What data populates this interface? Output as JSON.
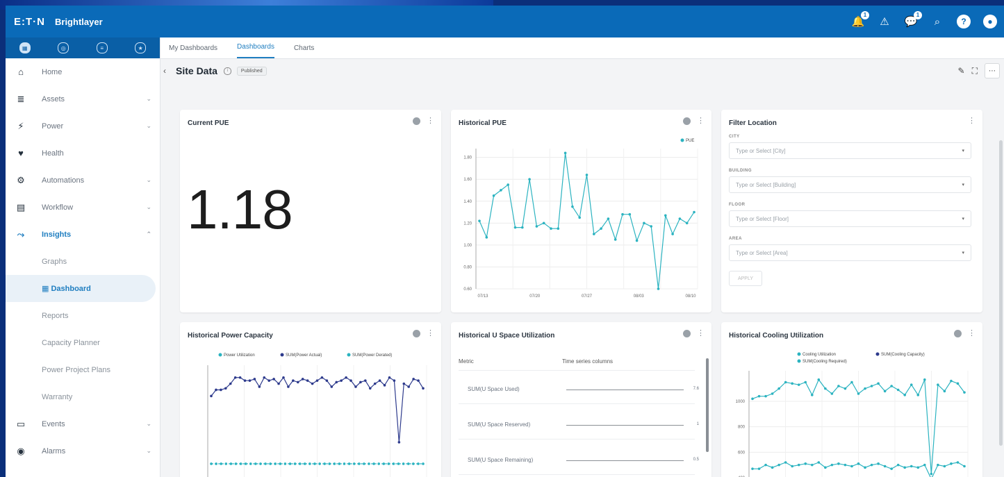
{
  "header": {
    "logo": "E:T·N",
    "app_name": "Brightlayer",
    "notif_count": "1",
    "chat_count": "1",
    "help_icon": "?",
    "user_icon": "user-circle-icon"
  },
  "sidebar": {
    "items": [
      {
        "label": "Home",
        "icon": "home-icon",
        "glyph": "⌂",
        "chevron": ""
      },
      {
        "label": "Assets",
        "icon": "assets-icon",
        "glyph": "≣",
        "chevron": "⌄"
      },
      {
        "label": "Power",
        "icon": "power-icon",
        "glyph": "⚡",
        "chevron": "⌄"
      },
      {
        "label": "Health",
        "icon": "health-icon",
        "glyph": "♥",
        "chevron": ""
      },
      {
        "label": "Automations",
        "icon": "automations-icon",
        "glyph": "⚙",
        "chevron": "⌄"
      },
      {
        "label": "Workflow",
        "icon": "workflow-icon",
        "glyph": "▤",
        "chevron": "⌄"
      },
      {
        "label": "Insights",
        "icon": "insights-icon",
        "glyph": "⤳",
        "chevron": "⌃"
      }
    ],
    "subitems": [
      "Graphs",
      "Dashboard",
      "Reports",
      "Capacity Planner",
      "Power Project Plans",
      "Warranty"
    ],
    "items_after": [
      {
        "label": "Events",
        "icon": "events-icon",
        "glyph": "▭",
        "chevron": "⌄"
      },
      {
        "label": "Alarms",
        "icon": "alarms-icon",
        "glyph": "◉",
        "chevron": "⌄"
      }
    ]
  },
  "tabs": [
    "My Dashboards",
    "Dashboards",
    "Charts"
  ],
  "page": {
    "title": "Site Data",
    "badge": "Published"
  },
  "current_pue": {
    "title": "Current PUE",
    "value": "1.18"
  },
  "filter": {
    "title": "Filter Location",
    "fields": [
      {
        "label": "CITY",
        "placeholder": "Type or Select [City]"
      },
      {
        "label": "BUILDING",
        "placeholder": "Type or Select [Building]"
      },
      {
        "label": "FLOOR",
        "placeholder": "Type or Select [Floor]"
      },
      {
        "label": "AREA",
        "placeholder": "Type or Select [Area]"
      }
    ],
    "apply_label": "APPLY"
  },
  "u_space": {
    "title": "Historical U Space Utilization",
    "col_metric": "Metric",
    "col_series": "Time series columns",
    "rows": [
      {
        "metric": "SUM(U Space Used)",
        "value": "7.6"
      },
      {
        "metric": "SUM(U Space Reserved)",
        "value": "1"
      },
      {
        "metric": "SUM(U Space Remaining)",
        "value": "0.5"
      }
    ]
  },
  "colors": {
    "topbar": "#0a6ab8",
    "accent": "#1f7ec0",
    "teal": "#2bb3c0",
    "navy": "#2d3a8c"
  },
  "chart_data": [
    {
      "type": "line",
      "title": "Historical PUE",
      "series": [
        {
          "name": "PUE",
          "color": "#2bb3c0",
          "values": [
            1.22,
            1.07,
            1.45,
            1.5,
            1.55,
            1.16,
            1.16,
            1.6,
            1.17,
            1.2,
            1.15,
            1.15,
            1.84,
            1.35,
            1.25,
            1.64,
            1.1,
            1.15,
            1.24,
            1.05,
            1.28,
            1.28,
            1.04,
            1.2,
            1.17,
            0.6,
            1.27,
            1.1,
            1.24,
            1.2,
            1.3
          ]
        }
      ],
      "x_ticks": [
        "07/13",
        "07/20",
        "07/27",
        "08/03",
        "08/10"
      ],
      "y_ticks": [
        "0.60",
        "0.80",
        "1.00",
        "1.20",
        "1.40",
        "1.60",
        "1.80"
      ],
      "ylim": [
        0.6,
        1.88
      ],
      "legend": "top-right"
    },
    {
      "type": "line",
      "title": "Historical Power Capacity",
      "series": [
        {
          "name": "Power Utilization",
          "color": "#2bb3c0",
          "values": [
            1.1,
            1.1,
            1.1,
            1.1,
            1.1,
            1.1,
            1.1,
            1.1,
            1.1,
            1.1,
            1.1,
            1.1,
            1.1,
            1.1,
            1.1,
            1.1,
            1.1,
            1.1,
            1.1,
            1.1,
            1.1,
            1.1,
            1.1,
            1.1,
            1.1,
            1.1,
            1.1,
            1.1,
            1.1,
            1.1,
            1.1,
            1.1,
            1.1,
            1.1,
            1.1,
            1.1,
            1.1,
            1.1,
            1.1,
            1.1,
            1.1,
            1.1,
            1.1,
            1.1
          ]
        },
        {
          "name": "SUM(Power Actual)",
          "color": "#2d3a8c",
          "values": [
            3.3,
            3.5,
            3.5,
            3.55,
            3.7,
            3.9,
            3.9,
            3.8,
            3.8,
            3.85,
            3.6,
            3.9,
            3.8,
            3.85,
            3.7,
            3.9,
            3.6,
            3.8,
            3.75,
            3.85,
            3.8,
            3.7,
            3.8,
            3.9,
            3.8,
            3.6,
            3.75,
            3.8,
            3.9,
            3.8,
            3.6,
            3.75,
            3.8,
            3.55,
            3.7,
            3.8,
            3.65,
            3.9,
            3.8,
            1.8,
            3.7,
            3.6,
            3.85,
            3.8,
            3.55
          ]
        },
        {
          "name": "SUM(Power Derated)",
          "color": "#2bb3c0",
          "values": []
        }
      ],
      "y_ticks": [
        "1e+6",
        "2e+6",
        "3e+6"
      ],
      "ylim": [
        0.4,
        4.3
      ],
      "legend": "top"
    },
    {
      "type": "line",
      "title": "Historical Cooling Utilization",
      "series": [
        {
          "name": "Cooling Utilization",
          "color": "#2bb3c0",
          "values": [
            1020,
            1040,
            1040,
            1060,
            1100,
            1150,
            1140,
            1130,
            1150,
            1050,
            1170,
            1100,
            1060,
            1120,
            1100,
            1150,
            1060,
            1100,
            1120,
            1140,
            1080,
            1120,
            1090,
            1050,
            1130,
            1050,
            1170,
            430,
            1130,
            1080,
            1160,
            1140,
            1070
          ]
        },
        {
          "name": "SUM(Cooling Capacity)",
          "color": "#2d3a8c",
          "values": []
        },
        {
          "name": "SUM(Cooling Required)",
          "color": "#2bb3c0",
          "values": [
            470,
            470,
            500,
            480,
            500,
            520,
            490,
            500,
            510,
            500,
            520,
            480,
            500,
            510,
            500,
            490,
            510,
            480,
            500,
            510,
            490,
            470,
            500,
            480,
            490,
            480,
            500,
            390,
            500,
            490,
            510,
            520,
            490
          ]
        }
      ],
      "y_ticks": [
        "400",
        "600",
        "800",
        "1000"
      ],
      "ylim": [
        340,
        1240
      ],
      "legend": "top"
    }
  ]
}
